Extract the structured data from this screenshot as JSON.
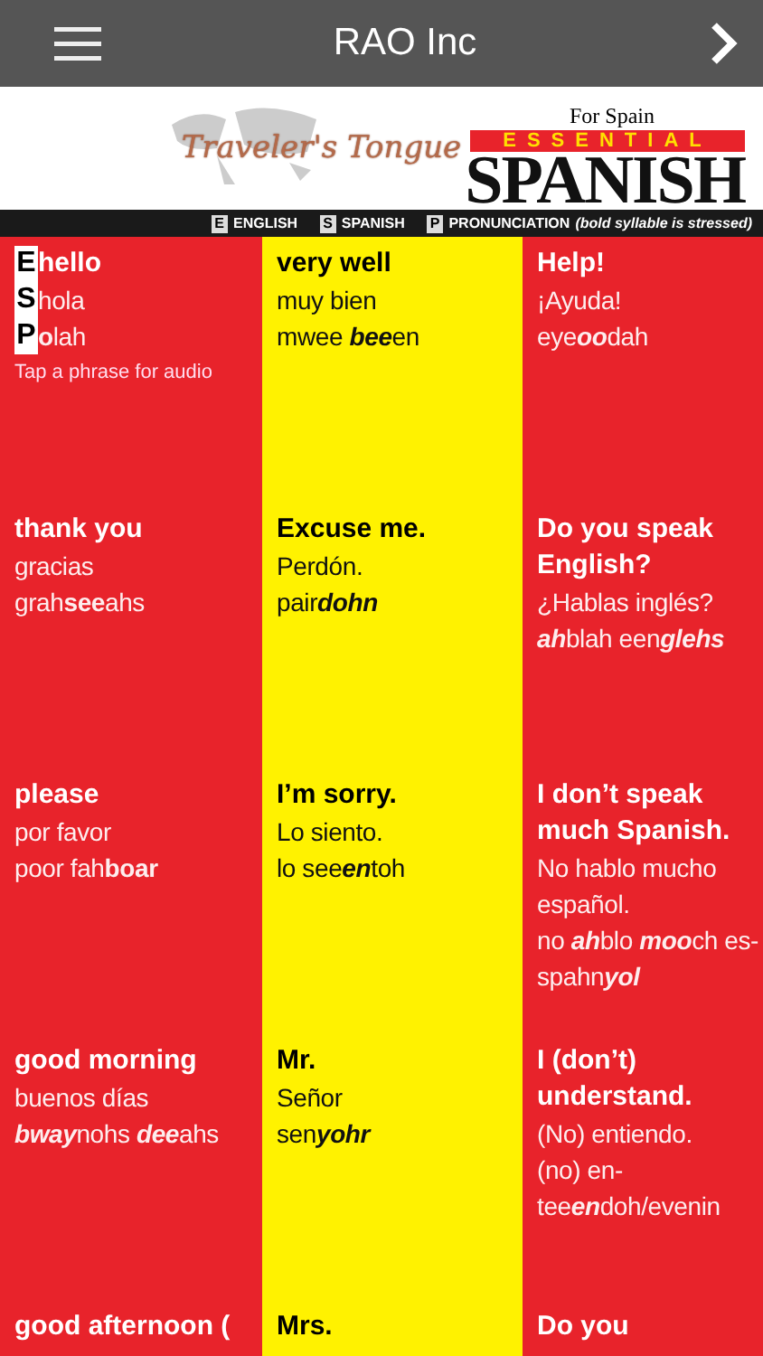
{
  "header": {
    "title": "RAO Inc"
  },
  "banner": {
    "script_logo": "Traveler's Tongue",
    "region": "For Spain",
    "ribbon": "ESSENTIAL",
    "title": "SPANISH"
  },
  "legend": [
    {
      "key": "E",
      "label": "ENGLISH"
    },
    {
      "key": "S",
      "label": "SPANISH"
    },
    {
      "key": "P",
      "label": "PRONUNCIATION",
      "note": "(bold syllable is stressed)"
    }
  ],
  "hint": "Tap a phrase for audio",
  "columns": [
    {
      "color": "#e8232b",
      "cells": [
        {
          "english": "hello",
          "spanish": "hola",
          "pronunciation": "**o**lah",
          "keys": [
            "E",
            "S",
            "P"
          ],
          "stress_italic": false
        },
        {
          "english": "thank you",
          "spanish": "gracias",
          "pronunciation": "grah**see**ahs",
          "stress_italic": false
        },
        {
          "english": "please",
          "spanish": "por favor",
          "pronunciation": "poor fah**boar**",
          "stress_italic": false
        },
        {
          "english": "good morning",
          "spanish": "buenos días",
          "pronunciation": "**bway**nohs **dee**ahs",
          "stress_italic": true
        },
        {
          "english": "good afternoon ("
        }
      ]
    },
    {
      "color": "#fff200",
      "cells": [
        {
          "english": "very well",
          "spanish": "muy bien",
          "pronunciation": "mwee **bee**en",
          "stress_italic": true
        },
        {
          "english": "Excuse me.",
          "spanish": "Perdón.",
          "pronunciation": "pair**dohn**",
          "stress_italic": true
        },
        {
          "english": "I’m sorry.",
          "spanish": "Lo siento.",
          "pronunciation": "lo see**en**toh",
          "stress_italic": true
        },
        {
          "english": "Mr.",
          "spanish": "Señor",
          "pronunciation": "sen**yohr**",
          "stress_italic": true
        },
        {
          "english": "Mrs."
        }
      ]
    },
    {
      "color": "#e8232b",
      "cells": [
        {
          "english": "Help!",
          "spanish": "¡Ayuda!",
          "pronunciation": "eye**oo**dah",
          "stress_italic": true
        },
        {
          "english": "Do you speak English?",
          "spanish": "¿Hablas inglés?",
          "pronunciation": "**ah**blah een**glehs**",
          "stress_italic": true
        },
        {
          "english": "I don’t speak much Spanish.",
          "spanish": "No hablo mucho español.",
          "pronunciation": "no **ah**blo **moo**ch es-spahn**yol**",
          "stress_italic": true
        },
        {
          "english": "I (don’t) understand.",
          "spanish": "(No) entiendo.",
          "pronunciation": "(no) en-tee**en**doh/evenin",
          "stress_italic": true
        },
        {
          "english": "Do you"
        }
      ]
    }
  ]
}
